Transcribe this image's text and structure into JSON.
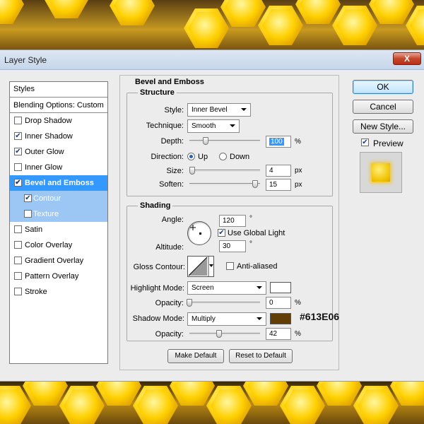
{
  "window": {
    "title": "Layer Style",
    "close_label": "X"
  },
  "sidebar": {
    "header": "Styles",
    "blending": "Blending Options: Custom",
    "items": [
      {
        "label": "Drop Shadow",
        "checked": false
      },
      {
        "label": "Inner Shadow",
        "checked": true
      },
      {
        "label": "Outer Glow",
        "checked": true
      },
      {
        "label": "Inner Glow",
        "checked": false
      },
      {
        "label": "Bevel and Emboss",
        "checked": true,
        "selected": true
      },
      {
        "label": "Contour",
        "checked": true,
        "sub": true
      },
      {
        "label": "Texture",
        "checked": false,
        "sub": true
      },
      {
        "label": "Satin",
        "checked": false
      },
      {
        "label": "Color Overlay",
        "checked": false
      },
      {
        "label": "Gradient Overlay",
        "checked": false
      },
      {
        "label": "Pattern Overlay",
        "checked": false
      },
      {
        "label": "Stroke",
        "checked": false
      }
    ]
  },
  "bevel": {
    "title": "Bevel and Emboss",
    "structure": {
      "legend": "Structure",
      "style_label": "Style:",
      "style_value": "Inner Bevel",
      "technique_label": "Technique:",
      "technique_value": "Smooth",
      "depth_label": "Depth:",
      "depth_value": "100",
      "depth_unit": "%",
      "direction_label": "Direction:",
      "up_label": "Up",
      "down_label": "Down",
      "direction": "Up",
      "size_label": "Size:",
      "size_value": "4",
      "size_unit": "px",
      "soften_label": "Soften:",
      "soften_value": "15",
      "soften_unit": "px"
    },
    "shading": {
      "legend": "Shading",
      "angle_label": "Angle:",
      "angle_value": "120",
      "angle_unit": "°",
      "global_light_label": "Use Global Light",
      "global_light": true,
      "altitude_label": "Altitude:",
      "altitude_value": "30",
      "altitude_unit": "°",
      "gloss_label": "Gloss Contour:",
      "anti_aliased_label": "Anti-aliased",
      "anti_aliased": false,
      "highlight_mode_label": "Highlight Mode:",
      "highlight_mode_value": "Screen",
      "highlight_color": "#ffffff",
      "highlight_opacity_label": "Opacity:",
      "highlight_opacity_value": "0",
      "highlight_opacity_unit": "%",
      "shadow_mode_label": "Shadow Mode:",
      "shadow_mode_value": "Multiply",
      "shadow_color": "#613E06",
      "shadow_opacity_label": "Opacity:",
      "shadow_opacity_value": "42",
      "shadow_opacity_unit": "%"
    },
    "make_default_label": "Make Default",
    "reset_default_label": "Reset to Default"
  },
  "annotation": {
    "color_hex": "#613E06"
  },
  "actions": {
    "ok_label": "OK",
    "cancel_label": "Cancel",
    "new_style_label": "New Style...",
    "preview_label": "Preview",
    "preview_checked": true
  }
}
